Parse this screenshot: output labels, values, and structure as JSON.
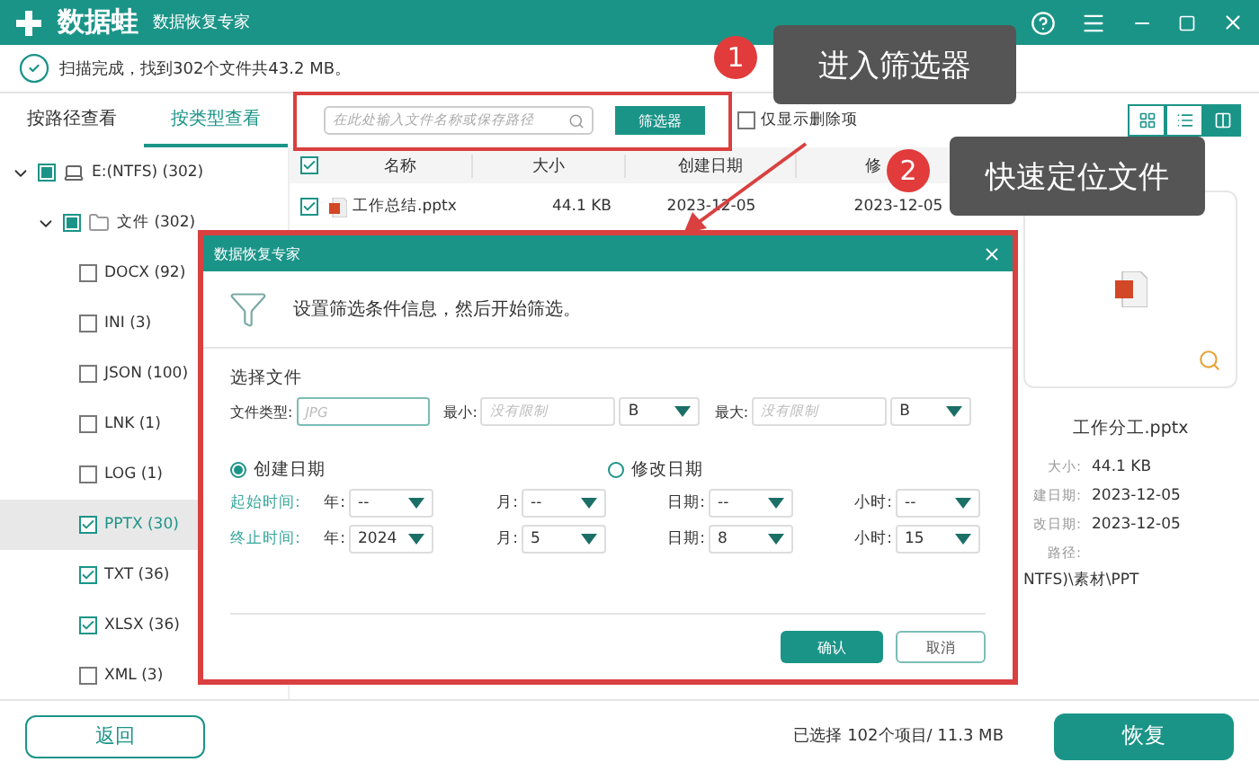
{
  "window": {
    "logo_text": "数据蛙",
    "subtitle": "数据恢复专家"
  },
  "status": {
    "message": "扫描完成，找到302个文件共43.2 MB。"
  },
  "view_tabs": [
    {
      "label": "按路径查看",
      "selected": false
    },
    {
      "label": "按类型查看",
      "selected": true
    }
  ],
  "search": {
    "placeholder": "在此处输入文件名称或保存路径"
  },
  "filter_button": "筛选器",
  "deleted_only": {
    "label": "仅显示删除项",
    "checked": false
  },
  "view_modes": [
    {
      "kind": "grid",
      "selected": false
    },
    {
      "kind": "list",
      "selected": false
    },
    {
      "kind": "detail",
      "selected": true
    }
  ],
  "tree": [
    {
      "label": "E:(NTFS) (302)",
      "kind": "drive",
      "checked": false,
      "partial": true,
      "expanded": true,
      "selected": false,
      "children": [
        {
          "label": "文件 (302)",
          "kind": "folder",
          "checked": false,
          "partial": true,
          "expanded": true,
          "selected": false,
          "children": [
            {
              "label": "DOCX (92)",
              "checked": false,
              "selected": false
            },
            {
              "label": "INI (3)",
              "checked": false,
              "selected": false
            },
            {
              "label": "JSON (100)",
              "checked": false,
              "selected": false
            },
            {
              "label": "LNK (1)",
              "checked": false,
              "selected": false
            },
            {
              "label": "LOG (1)",
              "checked": false,
              "selected": false
            },
            {
              "label": "PPTX (30)",
              "checked": true,
              "selected": true
            },
            {
              "label": "TXT (36)",
              "checked": true,
              "selected": false
            },
            {
              "label": "XLSX (36)",
              "checked": true,
              "selected": false
            },
            {
              "label": "XML (3)",
              "checked": false,
              "selected": false
            }
          ]
        }
      ]
    }
  ],
  "table": {
    "all_checked": true,
    "columns": [
      "名称",
      "大小",
      "创建日期",
      "修"
    ],
    "rows": [
      {
        "checked": true,
        "name": "工作总结.pptx",
        "size": "44.1 KB",
        "created": "2023-12-05",
        "modified": "2023-12-05"
      }
    ]
  },
  "preview": {
    "file_name": "工作分工.pptx",
    "details": [
      {
        "label": "大小:",
        "value": "44.1 KB"
      },
      {
        "label": "建日期:",
        "value": "2023-12-05"
      },
      {
        "label": "改日期:",
        "value": "2023-12-05"
      }
    ],
    "path_label": "路径:",
    "path": "NTFS)\\素材\\PPT"
  },
  "bottom": {
    "back_button": "返回",
    "selection": "已选择 102个项目/ 11.3 MB",
    "recover_button": "恢复"
  },
  "dialog": {
    "title": "数据恢复专家",
    "intro": "设置筛选条件信息，然后开始筛选。",
    "section": "选择文件",
    "type_field": {
      "label": "文件类型:",
      "placeholder": "JPG"
    },
    "size_fields": [
      {
        "label": "最小:",
        "placeholder": "没有限制",
        "unit": "B"
      },
      {
        "label": "最大:",
        "placeholder": "没有限制",
        "unit": "B"
      }
    ],
    "date_modes": [
      {
        "label": "创建日期",
        "selected": true
      },
      {
        "label": "修改日期",
        "selected": false
      }
    ],
    "time_rows": [
      {
        "label": "起始时间:",
        "selects": [
          {
            "label": "年:",
            "value": "--"
          },
          {
            "label": "月:",
            "value": "--"
          },
          {
            "label": "日期:",
            "value": "--"
          },
          {
            "label": "小时:",
            "value": "--"
          }
        ]
      },
      {
        "label": "终止时间:",
        "selects": [
          {
            "label": "年:",
            "value": "2024"
          },
          {
            "label": "月:",
            "value": "5"
          },
          {
            "label": "日期:",
            "value": "8"
          },
          {
            "label": "小时:",
            "value": "15"
          }
        ]
      }
    ],
    "buttons": [
      {
        "label": "确认",
        "kind": "primary"
      },
      {
        "label": "取消",
        "kind": "secondary"
      }
    ]
  },
  "callouts": [
    {
      "number": "1",
      "text": "进入筛选器"
    },
    {
      "number": "2",
      "text": "快速定位文件"
    }
  ]
}
